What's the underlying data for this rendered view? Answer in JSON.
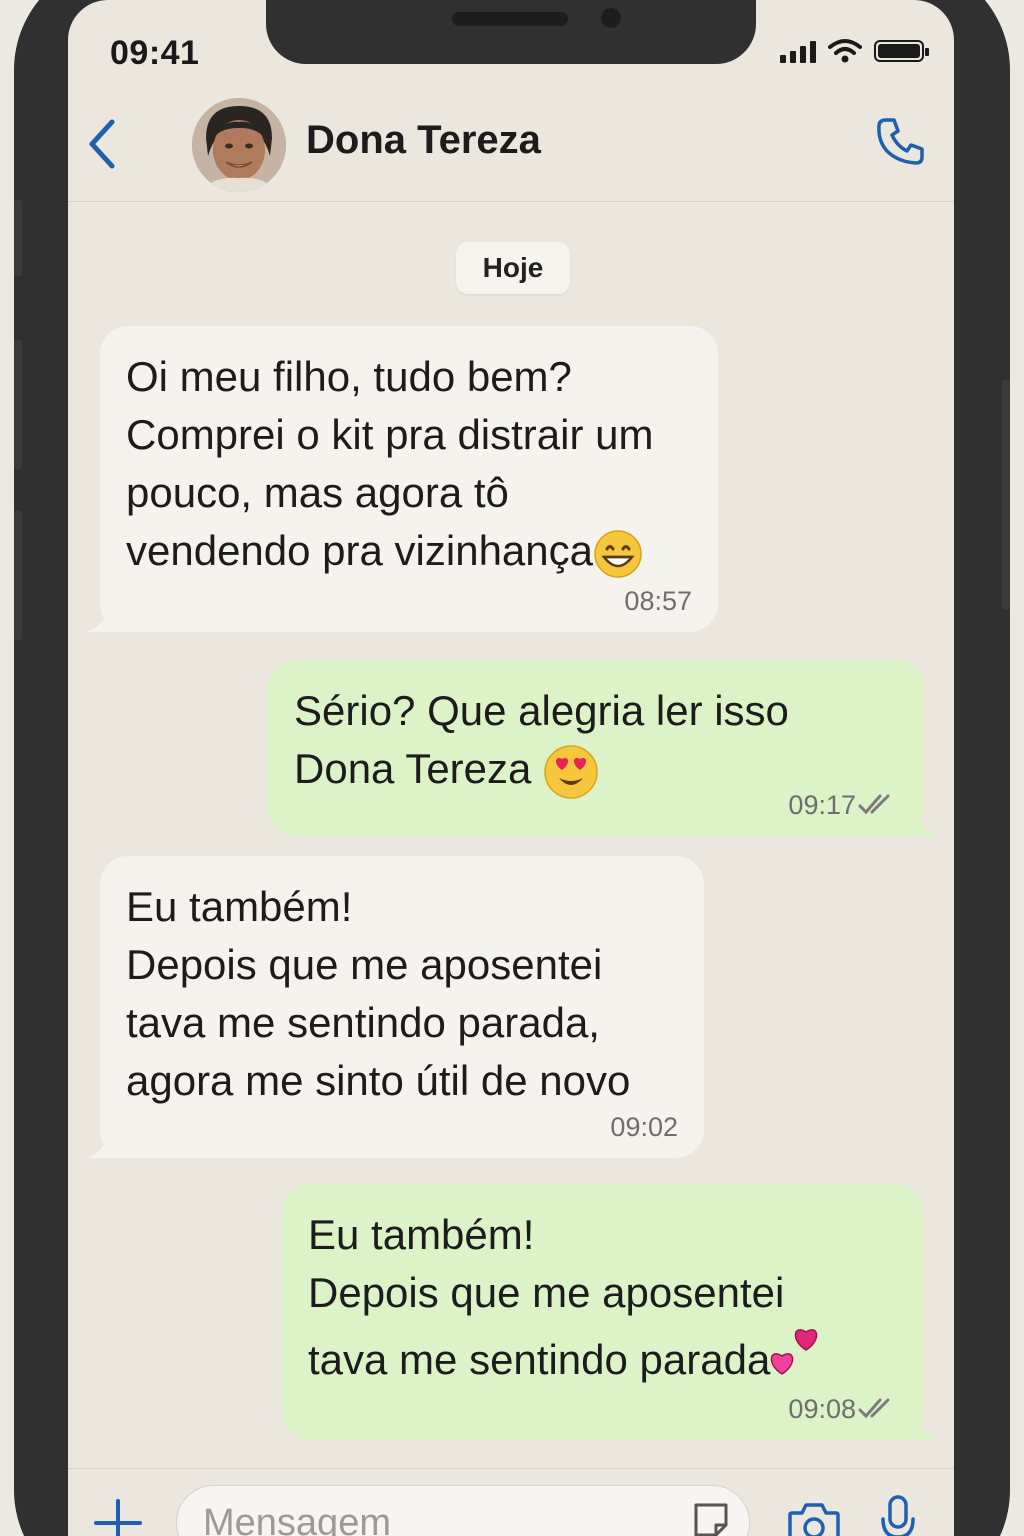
{
  "status_bar": {
    "time": "09:41"
  },
  "header": {
    "contact_name": "Dona Tereza"
  },
  "date_chip": "Hoje",
  "messages": [
    {
      "direction": "in",
      "text": "Oi meu filho, tudo bem?\nComprei o kit pra distrair um\npouco, mas agora tô\nvendendo pra vizinhança",
      "emoji": "grinning-face",
      "time": "08:57"
    },
    {
      "direction": "out",
      "text": "Sério? Que alegria ler isso\nDona Tereza ",
      "emoji": "heart-eyes-face",
      "time": "09:17",
      "read": true
    },
    {
      "direction": "in",
      "text": "Eu também!\nDepois que me aposentei\ntava me sentindo parada,\nagora me sinto útil de novo",
      "time": "09:02"
    },
    {
      "direction": "out",
      "text": "Eu também!\nDepois que me aposentei\ntava me sentindo parada",
      "emoji": "two-hearts",
      "time": "09:08",
      "read": true
    }
  ],
  "input": {
    "placeholder": "Mensagem"
  },
  "colors": {
    "accent": "#1f5fb0",
    "incoming_bubble": "#f5f3ee",
    "outgoing_bubble": "#dcf3c8",
    "background": "#ebe7df"
  }
}
